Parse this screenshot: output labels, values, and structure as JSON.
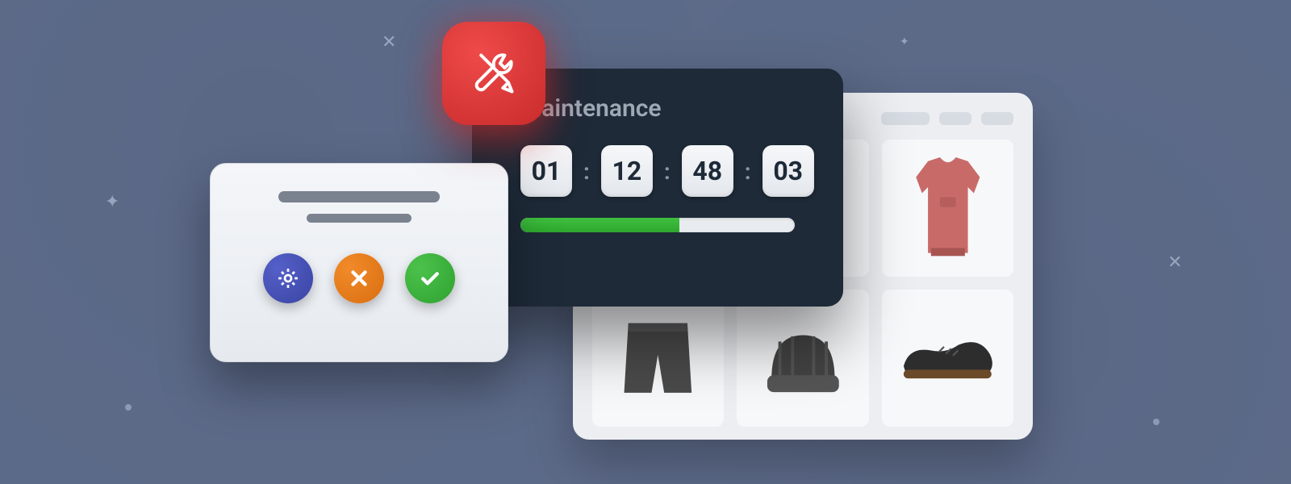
{
  "maintenance": {
    "title": "Maintenance",
    "countdown": {
      "days": "01",
      "hours": "12",
      "minutes": "48",
      "seconds": "03"
    },
    "progress_percent": 58
  },
  "dialog": {
    "settings_label": "Settings",
    "cancel_label": "Cancel",
    "confirm_label": "Confirm"
  },
  "store": {
    "products": [
      "sweater",
      "shorts",
      "beanie",
      "shoe"
    ]
  },
  "icons": {
    "tools": "tools-icon",
    "gear": "gear-icon",
    "close": "close-icon",
    "check": "check-icon"
  },
  "colors": {
    "bg": "#5d6b8a",
    "maint_card": "#1e2a38",
    "accent_red": "#d93333",
    "accent_green": "#33b233",
    "accent_orange": "#e87a1a",
    "accent_purple": "#4650b0"
  }
}
